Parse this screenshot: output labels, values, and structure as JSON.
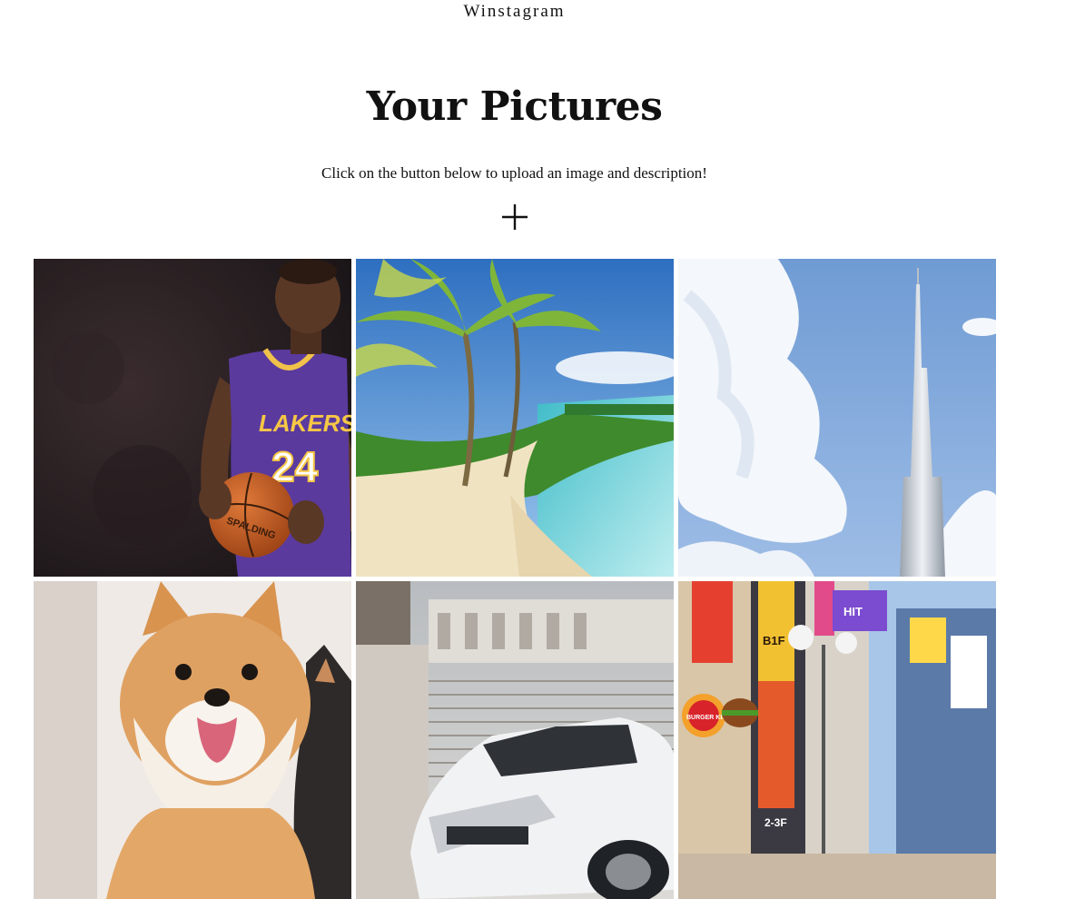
{
  "header": {
    "brand": "Winstagram"
  },
  "main": {
    "title": "Your Pictures",
    "subtitle": "Click on the button below to upload an image and description!",
    "add_icon": "plus-icon"
  },
  "gallery": {
    "photos": [
      {
        "name": "photo-basketball-player",
        "jersey_text": "LAKERS",
        "jersey_number": "24",
        "ball_text": "SPALDING"
      },
      {
        "name": "photo-tropical-beach"
      },
      {
        "name": "photo-skyscraper"
      },
      {
        "name": "photo-shiba-dog"
      },
      {
        "name": "photo-white-suv"
      },
      {
        "name": "photo-city-street",
        "sign_texts": [
          "BURGER KING",
          "B1F",
          "HIT",
          "2-3F"
        ]
      }
    ]
  },
  "colors": {
    "background": "#ffffff",
    "text": "#111111"
  }
}
